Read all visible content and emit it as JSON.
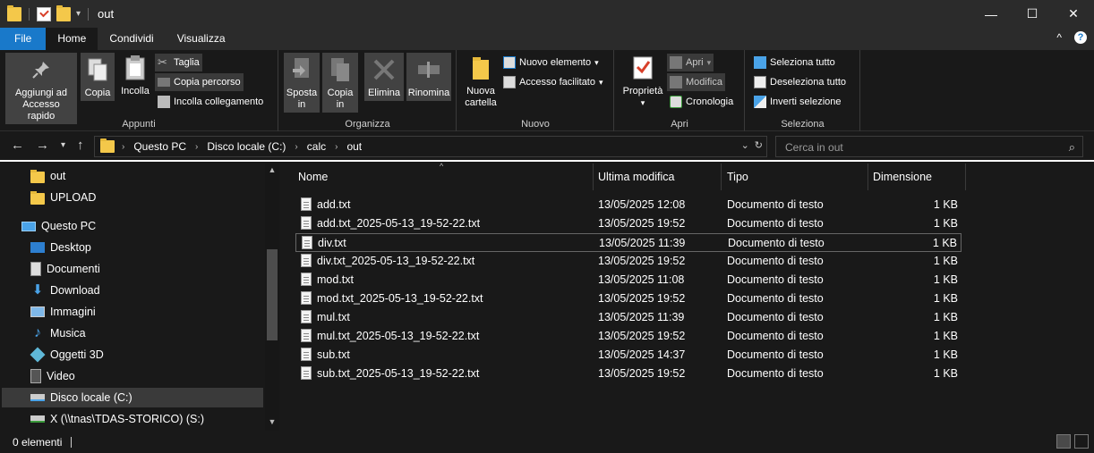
{
  "window": {
    "title": "out"
  },
  "window_controls": {
    "minimize": "—",
    "maximize": "☐",
    "close": "✕"
  },
  "ribbon_tabs": [
    "File",
    "Home",
    "Condividi",
    "Visualizza"
  ],
  "ribbon": {
    "appunti": {
      "label": "Appunti",
      "pin_line1": "Aggiungi ad",
      "pin_line2": "Accesso rapido",
      "copy": "Copia",
      "paste": "Incolla",
      "cut": "Taglia",
      "copy_path": "Copia percorso",
      "paste_shortcut": "Incolla collegamento"
    },
    "organizza": {
      "label": "Organizza",
      "move_line1": "Sposta",
      "move_line2": "in",
      "copy_line1": "Copia",
      "copy_line2": "in",
      "delete": "Elimina",
      "rename": "Rinomina"
    },
    "nuovo": {
      "label": "Nuovo",
      "new_folder_line1": "Nuova",
      "new_folder_line2": "cartella",
      "new_item": "Nuovo elemento",
      "easy_access": "Accesso facilitato"
    },
    "apri": {
      "label": "Apri",
      "properties": "Proprietà",
      "open": "Apri",
      "edit": "Modifica",
      "history": "Cronologia"
    },
    "seleziona": {
      "label": "Seleziona",
      "select_all": "Seleziona tutto",
      "select_none": "Deseleziona tutto",
      "invert": "Inverti selezione"
    }
  },
  "address": {
    "crumbs": [
      "Questo PC",
      "Disco locale (C:)",
      "calc",
      "out"
    ],
    "search_placeholder": "Cerca in out"
  },
  "nav_pane": [
    {
      "label": "out",
      "icon": "folder-icon"
    },
    {
      "label": "UPLOAD",
      "icon": "folder-icon"
    },
    {
      "label": "Questo PC",
      "icon": "pc-icon"
    },
    {
      "label": "Desktop",
      "icon": "desktop-icon"
    },
    {
      "label": "Documenti",
      "icon": "documents-icon"
    },
    {
      "label": "Download",
      "icon": "download-icon"
    },
    {
      "label": "Immagini",
      "icon": "pictures-icon"
    },
    {
      "label": "Musica",
      "icon": "music-icon"
    },
    {
      "label": "Oggetti 3D",
      "icon": "objects3d-icon"
    },
    {
      "label": "Video",
      "icon": "video-icon"
    },
    {
      "label": "Disco locale (C:)",
      "icon": "drive-icon"
    },
    {
      "label": "X (\\\\tnas\\TDAS-STORICO) (S:)",
      "icon": "network-drive-icon"
    }
  ],
  "columns": [
    "Nome",
    "Ultima modifica",
    "Tipo",
    "Dimensione"
  ],
  "files": [
    {
      "name": "add.txt",
      "modified": "13/05/2025 12:08",
      "type": "Documento di testo",
      "size": "1 KB"
    },
    {
      "name": "add.txt_2025-05-13_19-52-22.txt",
      "modified": "13/05/2025 19:52",
      "type": "Documento di testo",
      "size": "1 KB"
    },
    {
      "name": "div.txt",
      "modified": "13/05/2025 11:39",
      "type": "Documento di testo",
      "size": "1 KB"
    },
    {
      "name": "div.txt_2025-05-13_19-52-22.txt",
      "modified": "13/05/2025 19:52",
      "type": "Documento di testo",
      "size": "1 KB"
    },
    {
      "name": "mod.txt",
      "modified": "13/05/2025 11:08",
      "type": "Documento di testo",
      "size": "1 KB"
    },
    {
      "name": "mod.txt_2025-05-13_19-52-22.txt",
      "modified": "13/05/2025 19:52",
      "type": "Documento di testo",
      "size": "1 KB"
    },
    {
      "name": "mul.txt",
      "modified": "13/05/2025 11:39",
      "type": "Documento di testo",
      "size": "1 KB"
    },
    {
      "name": "mul.txt_2025-05-13_19-52-22.txt",
      "modified": "13/05/2025 19:52",
      "type": "Documento di testo",
      "size": "1 KB"
    },
    {
      "name": "sub.txt",
      "modified": "13/05/2025 14:37",
      "type": "Documento di testo",
      "size": "1 KB"
    },
    {
      "name": "sub.txt_2025-05-13_19-52-22.txt",
      "modified": "13/05/2025 19:52",
      "type": "Documento di testo",
      "size": "1 KB"
    }
  ],
  "status": {
    "count": "0 elementi"
  },
  "colors": {
    "accent": "#1979ca",
    "folder": "#f4c84a",
    "background": "#191919",
    "chrome": "#2b2b2b"
  }
}
